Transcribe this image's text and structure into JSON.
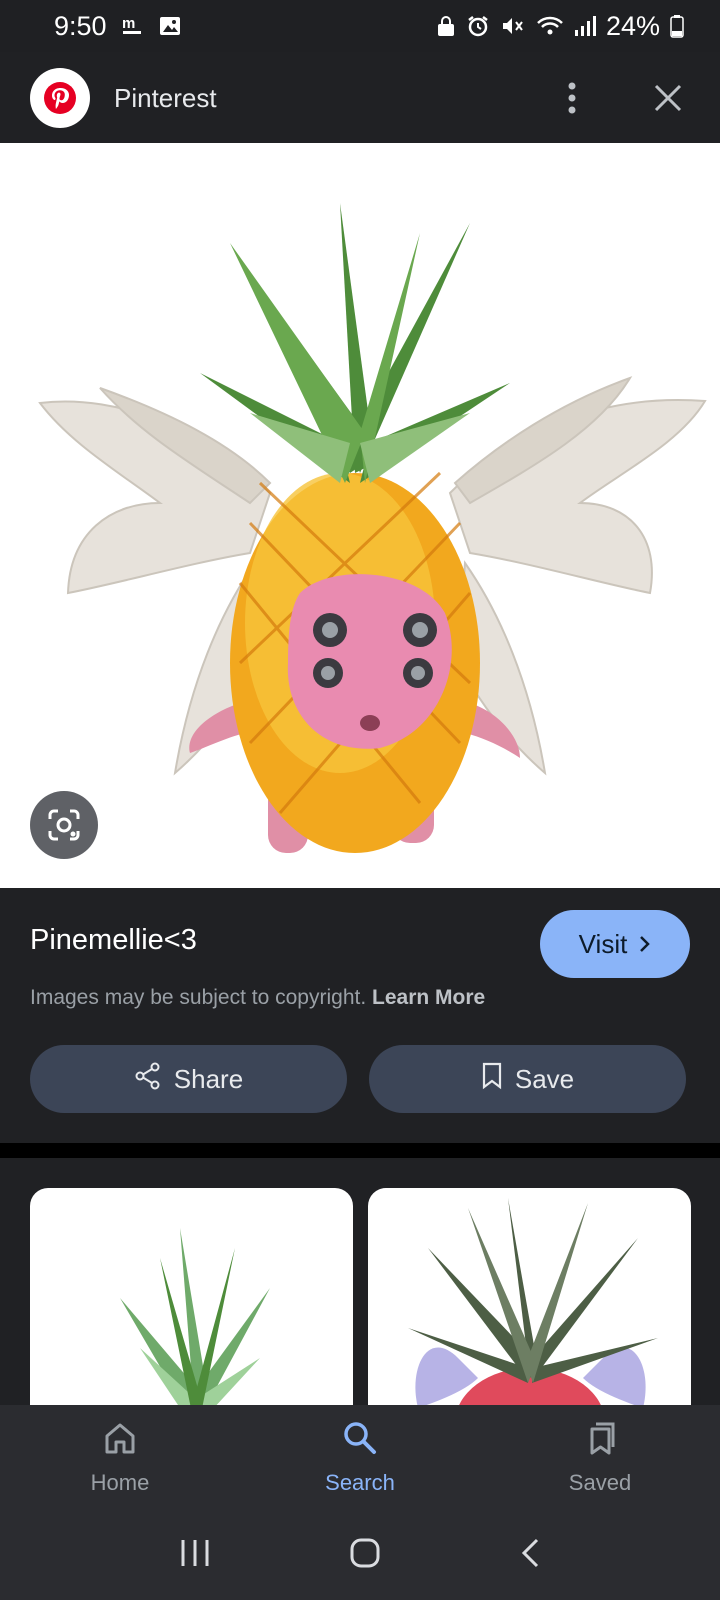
{
  "status_bar": {
    "time": "9:50",
    "battery": "24%",
    "left_icons": [
      "m-zone-icon",
      "gallery-icon"
    ],
    "right_icons": [
      "vpn-lock-icon",
      "alarm-icon",
      "mute-icon",
      "wifi-icon",
      "signal-icon",
      "battery-icon"
    ]
  },
  "app_bar": {
    "title": "Pinterest",
    "logo": "pinterest-logo",
    "brand_color": "#e60023"
  },
  "hero": {
    "image": "pineapple-fairy-creature",
    "lens_icon": "google-lens-icon"
  },
  "info": {
    "title": "Pinemellie<3",
    "visit_label": "Visit",
    "copyright_text": "Images may be subject to copyright.",
    "learn_more_label": "Learn More",
    "share_label": "Share",
    "save_label": "Save",
    "accent_color": "#8ab4f8"
  },
  "related": {
    "cards": [
      {
        "image": "green-pineapple-top"
      },
      {
        "image": "pink-pineapple-fairy"
      }
    ]
  },
  "bottom_nav": {
    "items": [
      {
        "label": "Home",
        "icon": "home-icon",
        "active": false
      },
      {
        "label": "Search",
        "icon": "search-icon",
        "active": true
      },
      {
        "label": "Saved",
        "icon": "bookmark-stack-icon",
        "active": false
      }
    ]
  },
  "system_nav": {
    "buttons": [
      "recents-icon",
      "home-circle-icon",
      "back-icon"
    ]
  }
}
